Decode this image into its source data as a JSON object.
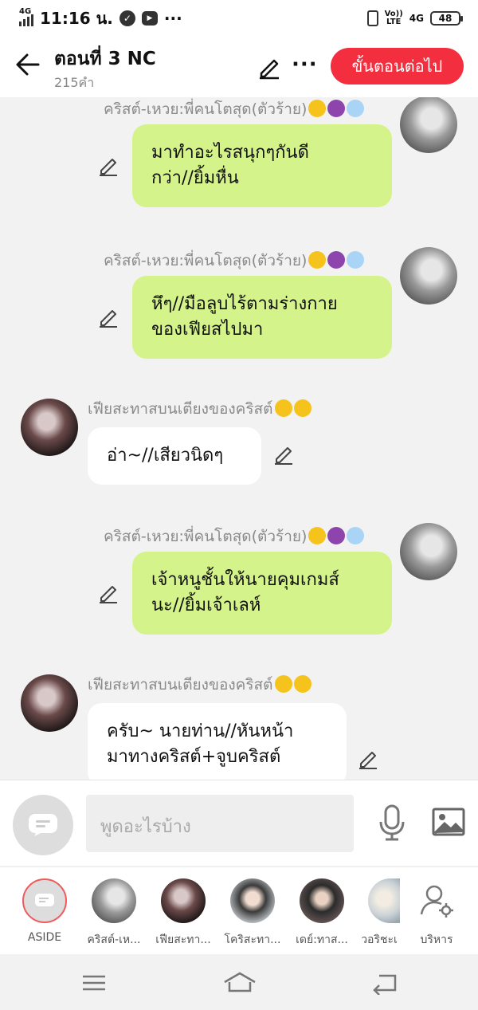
{
  "status_bar": {
    "network": "4G",
    "time": "11:16 น.",
    "dots": "···",
    "volte_top": "Vo))",
    "volte_bottom": "LTE",
    "network_right": "4G",
    "battery": "48"
  },
  "header": {
    "title": "ตอนที่ 3 NC",
    "word_count": "215คำ",
    "more": "···",
    "next_button": "ขั้นตอนต่อไป"
  },
  "messages": [
    {
      "side": "right",
      "name": "คริสต์-เหวย:พี่คนโตสุด(ตัวร้าย)",
      "lines": [
        "มาทำอะไรสนุกๆกันดี",
        "กว่า//ยิ้มหื่น"
      ]
    },
    {
      "side": "right",
      "name": "คริสต์-เหวย:พี่คนโตสุด(ตัวร้าย)",
      "lines": [
        "หึๆ//มือลูบไร้ตามร่างกาย",
        "ของเฟียสไปมา"
      ]
    },
    {
      "side": "left",
      "name": "เฟียสะทาสบนเตียงของคริสต์",
      "lines": [
        "อ่า~//เสียวนิดๆ"
      ]
    },
    {
      "side": "right",
      "name": "คริสต์-เหวย:พี่คนโตสุด(ตัวร้าย)",
      "lines": [
        "เจ้าหนูชั้นให้นายคุมเกมส์",
        "นะ//ยิ้มเจ้าเลห์"
      ]
    },
    {
      "side": "left",
      "name": "เฟียสะทาสบนเตียงของคริสต์",
      "lines": [
        "ครับ~ นายท่าน//หันหน้า",
        "มาทางคริสต์+จูบคริสต์"
      ]
    }
  ],
  "input": {
    "placeholder": "พูดอะไรบ้าง"
  },
  "characters": [
    {
      "label": "ASIDE"
    },
    {
      "label": "คริสต์-เห..."
    },
    {
      "label": "เฟียสะทา..."
    },
    {
      "label": "โคริสะทา..."
    },
    {
      "label": "เดย์:ทาส..."
    },
    {
      "label": "วอริชะเ"
    },
    {
      "label": "บริหาร"
    }
  ],
  "colors": {
    "accent": "#f22e3f",
    "bubble_self": "#d5f38b",
    "bubble_other": "#ffffff"
  }
}
